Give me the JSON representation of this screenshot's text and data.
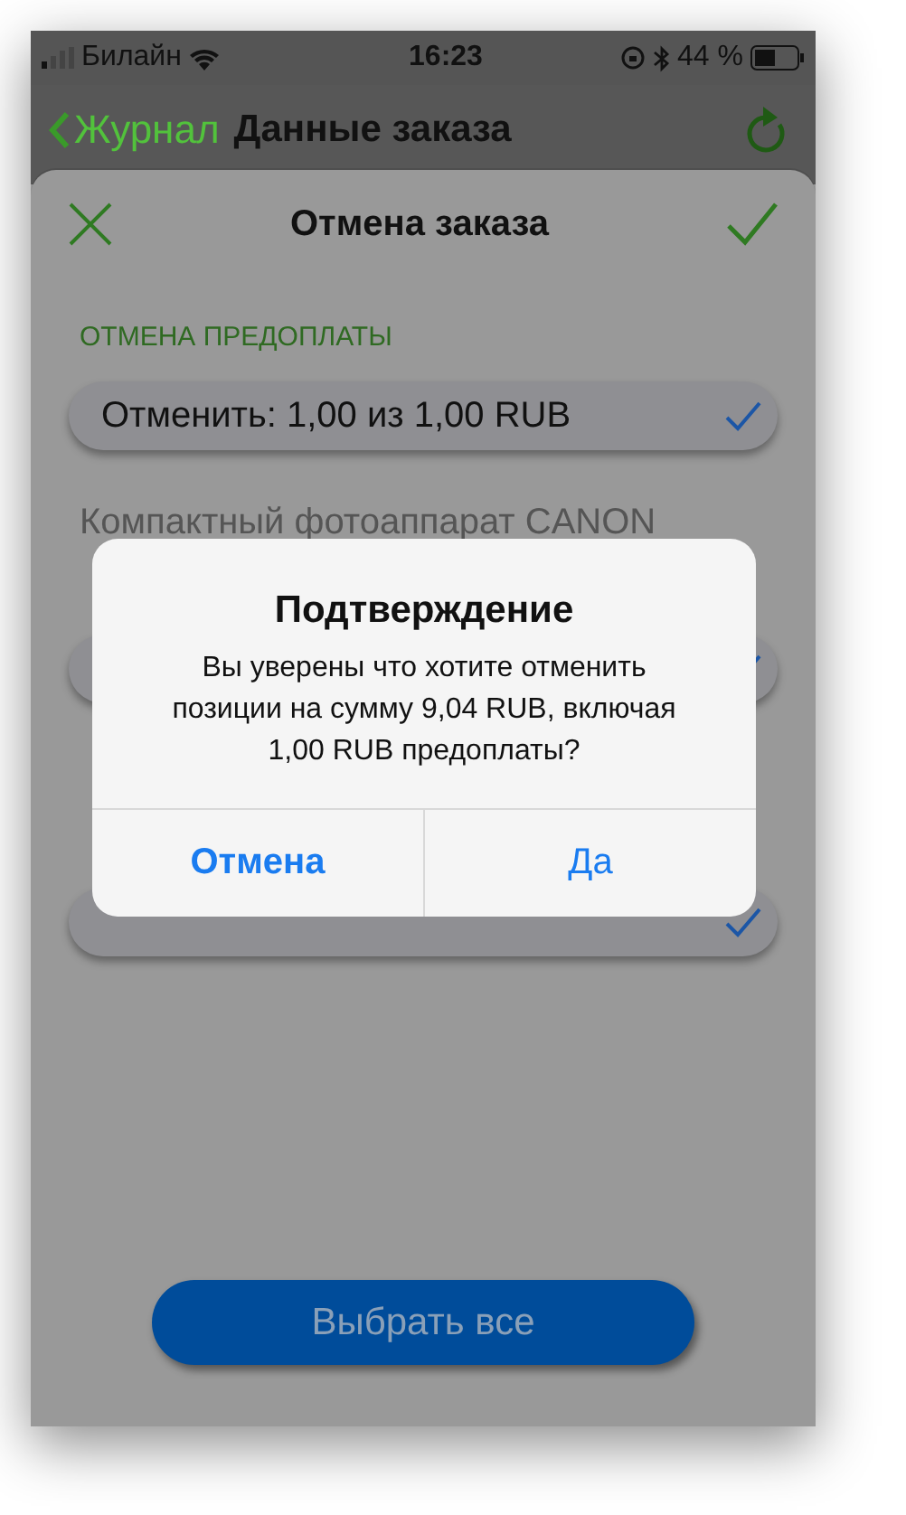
{
  "status_bar": {
    "carrier": "Билайн",
    "time": "16:23",
    "battery_percent": "44 %"
  },
  "nav_bar": {
    "back_label": "Журнал",
    "title": "Данные заказа"
  },
  "sheet": {
    "title": "Отмена заказа",
    "section_label": "ОТМЕНА ПРЕДОПЛАТЫ",
    "items": [
      {
        "kind": "row",
        "text": "Отменить: 1,00 из 1,00 RUB",
        "checked": true
      },
      {
        "kind": "title",
        "text": "Компактный фотоаппарат CANON"
      },
      {
        "kind": "row",
        "checked": true
      },
      {
        "kind": "title"
      },
      {
        "kind": "row",
        "checked": true
      }
    ],
    "select_all_button": "Выбрать все"
  },
  "dialog": {
    "title": "Подтверждение",
    "message_lines": [
      "Вы уверены что хотите отменить",
      "позиции на сумму 9,04 RUB, включая",
      "1,00 RUB предоплаты?"
    ],
    "buttons": [
      {
        "label": "Отмена",
        "bold": true
      },
      {
        "label": "Да",
        "bold": false
      }
    ]
  }
}
